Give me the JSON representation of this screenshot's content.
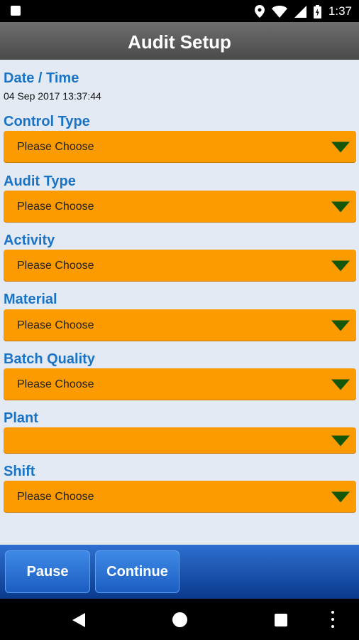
{
  "status_bar": {
    "time": "1:37",
    "icons": [
      "notification-icon",
      "location-icon",
      "wifi-icon",
      "signal-icon",
      "battery-icon"
    ]
  },
  "header": {
    "title": "Audit Setup"
  },
  "form": {
    "date_time": {
      "label": "Date / Time",
      "value": "04 Sep 2017 13:37:44"
    },
    "fields": [
      {
        "label": "Control Type",
        "value": "Please Choose"
      },
      {
        "label": "Audit Type",
        "value": "Please Choose"
      },
      {
        "label": "Activity",
        "value": "Please Choose"
      },
      {
        "label": "Material",
        "value": "Please Choose"
      },
      {
        "label": "Batch Quality",
        "value": "Please Choose"
      },
      {
        "label": "Plant",
        "value": ""
      },
      {
        "label": "Shift",
        "value": "Please Choose"
      }
    ]
  },
  "buttons": {
    "pause": "Pause",
    "continue": "Continue"
  },
  "colors": {
    "label": "#1a73c4",
    "dropdown": "#fb9b00",
    "caret": "#14560a",
    "button_bar": "#0a3a8c"
  }
}
